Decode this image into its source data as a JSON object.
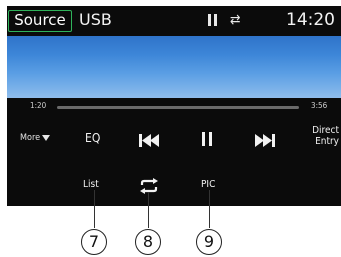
{
  "topbar": {
    "source_label": "Source",
    "source_name": "USB",
    "clock": "14:20"
  },
  "progress": {
    "elapsed": "1:20",
    "total": "3:56",
    "fraction": 0.0
  },
  "controls": {
    "more_label": "More",
    "eq_label": "EQ",
    "direct_entry_line1": "Direct",
    "direct_entry_line2": "Entry",
    "list_label": "List",
    "pic_label": "PIC"
  },
  "callouts": [
    {
      "number": "7"
    },
    {
      "number": "8"
    },
    {
      "number": "9"
    }
  ],
  "colors": {
    "accent": "#2fb35a",
    "screen_bg": "#0b0b0b",
    "video_top": "#2f73c9",
    "video_bottom": "#8fbdec"
  }
}
